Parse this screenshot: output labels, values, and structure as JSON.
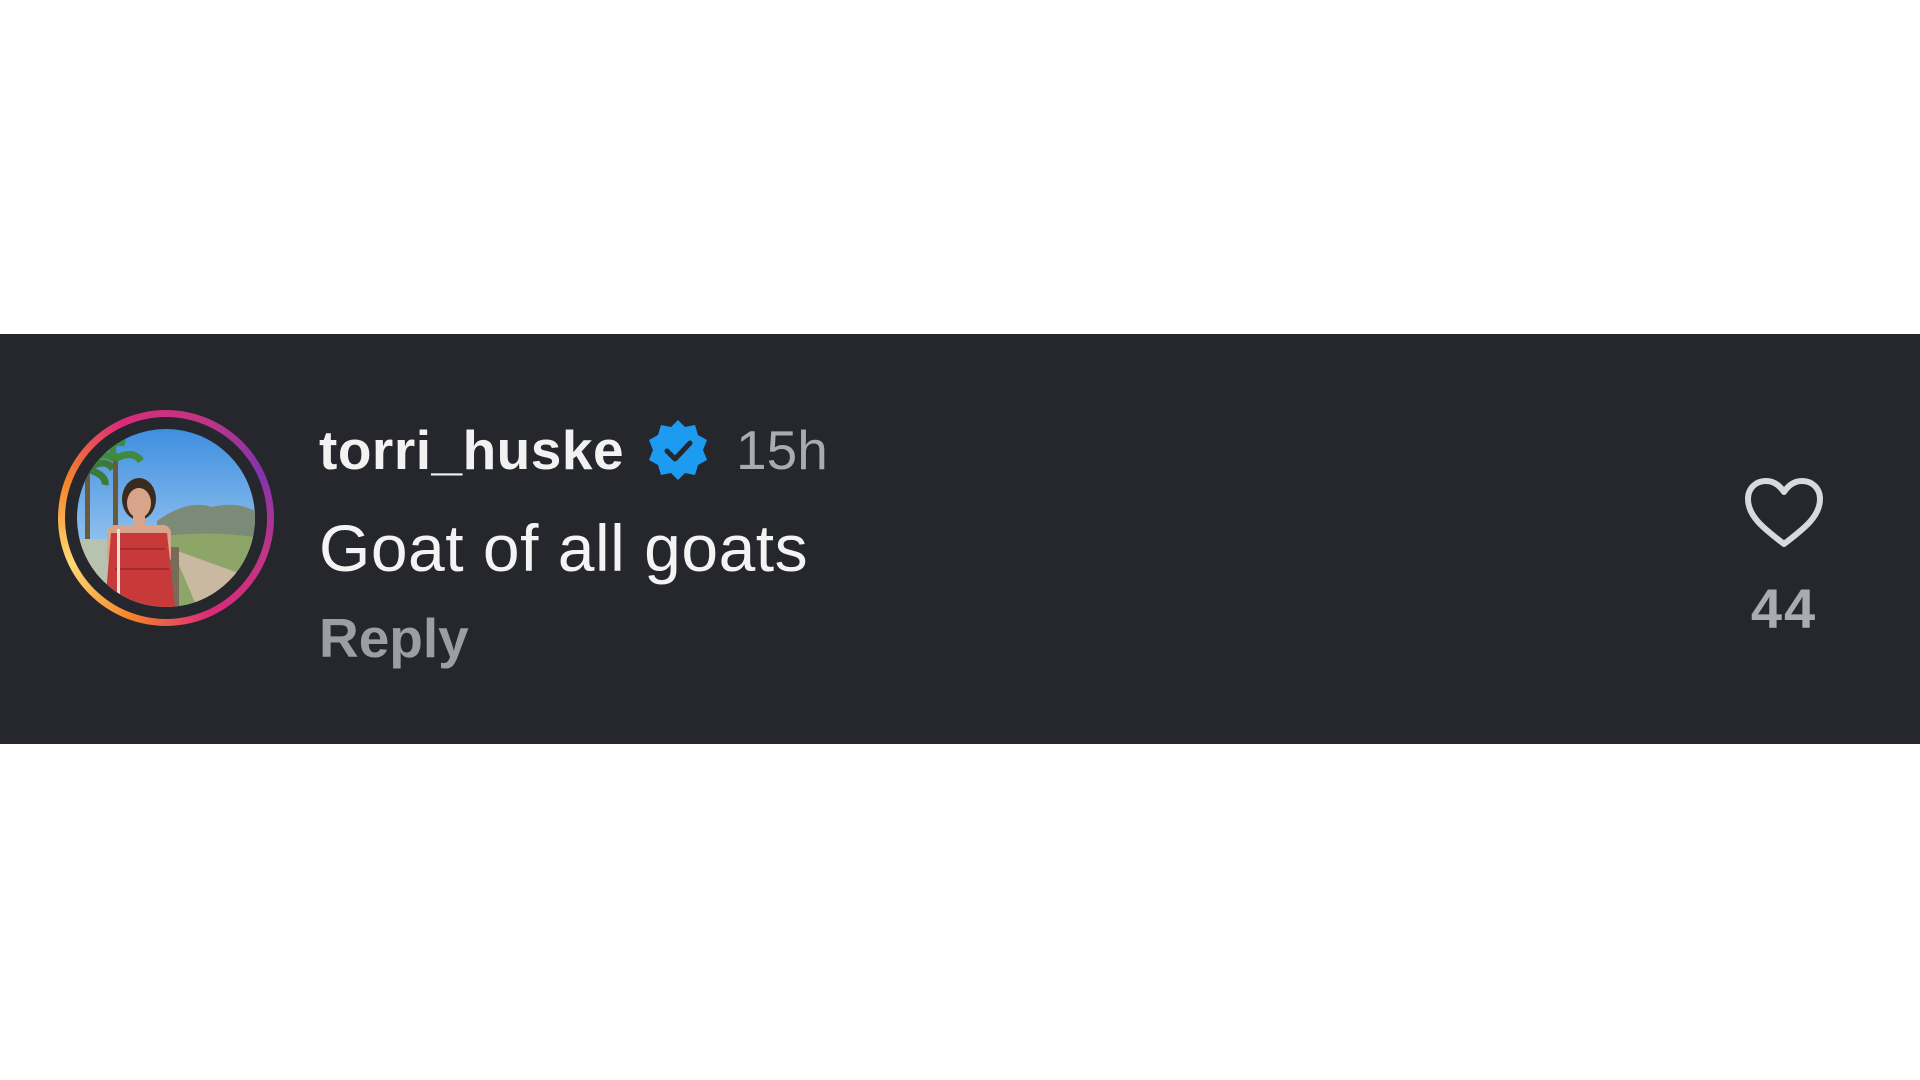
{
  "comment": {
    "username": "torri_huske",
    "verified": true,
    "timestamp": "15h",
    "text": "Goat of all goats",
    "reply_label": "Reply",
    "like_count": "44",
    "avatar_icon": "user-avatar-photo",
    "verified_icon": "verified-badge-icon",
    "like_icon": "heart-outline-icon"
  },
  "colors": {
    "band_background": "#25272c",
    "verified_blue": "#1d9bf0",
    "username": "#f2f2f2",
    "muted_text": "#a8abb1"
  }
}
